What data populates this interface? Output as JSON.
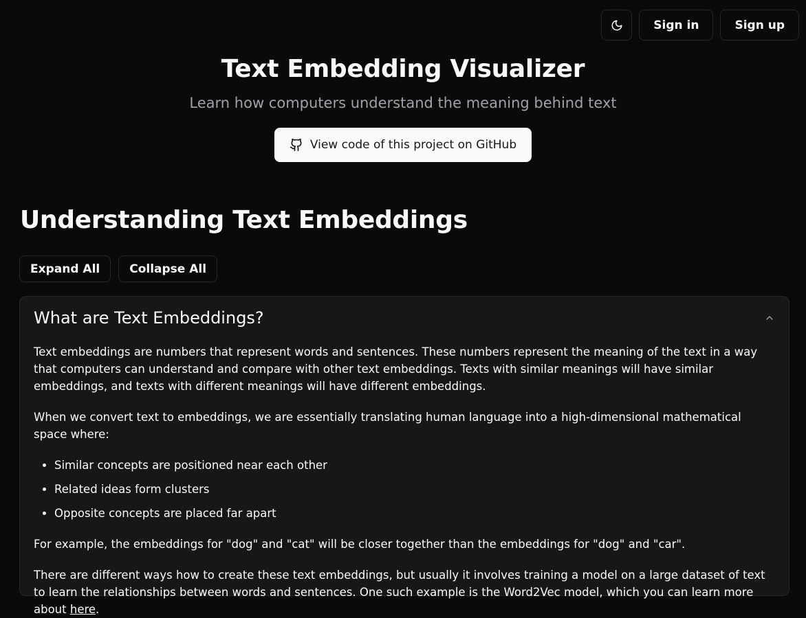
{
  "header": {
    "sign_in": "Sign in",
    "sign_up": "Sign up"
  },
  "hero": {
    "title": "Text Embedding Visualizer",
    "subtitle": "Learn how computers understand the meaning behind text",
    "github_button": "View code of this project on GitHub"
  },
  "section": {
    "title": "Understanding Text Embeddings",
    "expand_all": "Expand All",
    "collapse_all": "Collapse All"
  },
  "accordion": {
    "title": "What are Text Embeddings?",
    "para1": "Text embeddings are numbers that represent words and sentences. These numbers represent the meaning of the text in a way that computers can understand and compare with other text embeddings. Texts with similar meanings will have similar embeddings, and texts with different meanings will have different embeddings.",
    "para2": "When we convert text to embeddings, we are essentially translating human language into a high-dimensional mathematical space where:",
    "bullets": [
      "Similar concepts are positioned near each other",
      "Related ideas form clusters",
      "Opposite concepts are placed far apart"
    ],
    "para3": "For example, the embeddings for \"dog\" and \"cat\" will be closer together than the embeddings for \"dog\" and \"car\".",
    "para4": "There are different ways how to create these text embeddings, but usually it involves training a model on a large dataset of text to learn the relationships between words and sentences. One such example is the Word2Vec model, which you can learn more about ",
    "link": "here",
    "para4_end": "."
  },
  "icons": {
    "theme_toggle": "moon-icon",
    "github": "github-icon",
    "chevron": "chevron-up-icon"
  }
}
